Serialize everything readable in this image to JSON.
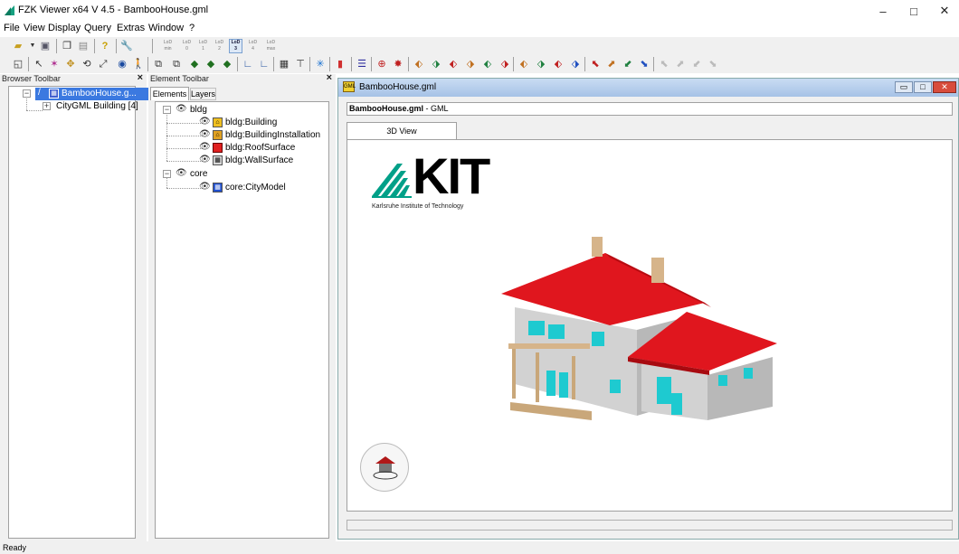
{
  "window": {
    "title": "FZK Viewer x64 V 4.5 - BambooHouse.gml",
    "controls": {
      "minimize": "–",
      "maximize": "□",
      "close": "✕"
    }
  },
  "menu": {
    "items": [
      "File",
      "View",
      "Display",
      "Query",
      "Extras",
      "Window",
      "?"
    ]
  },
  "lod_toolbar": {
    "buttons": [
      {
        "top": "LoD",
        "bottom": "min",
        "active": false
      },
      {
        "top": "LoD",
        "bottom": "0",
        "active": false
      },
      {
        "top": "LoD",
        "bottom": "1",
        "active": false
      },
      {
        "top": "LoD",
        "bottom": "2",
        "active": false
      },
      {
        "top": "LoD",
        "bottom": "3",
        "active": true
      },
      {
        "top": "LoD",
        "bottom": "4",
        "active": false
      },
      {
        "top": "LoD",
        "bottom": "max",
        "active": false
      }
    ]
  },
  "browser_panel": {
    "header": "Browser Toolbar",
    "close": "×",
    "root_label": "BambooHouse.g...",
    "child_label": "CityGML Building [4]"
  },
  "element_panel": {
    "header": "Element Toolbar",
    "close": "×",
    "tabs": [
      "Elements",
      "Layers"
    ],
    "groups": [
      {
        "name": "bldg",
        "items": [
          "bldg:Building",
          "bldg:BuildingInstallation",
          "bldg:RoofSurface",
          "bldg:WallSurface"
        ]
      },
      {
        "name": "core",
        "items": [
          "core:CityModel"
        ]
      }
    ]
  },
  "document": {
    "title": "BambooHouse.gml",
    "file_name": "BambooHouse.gml",
    "file_type": " - GML",
    "tab": "3D View",
    "logo_text": "KIT",
    "logo_subtitle": "Karlsruhe Institute of Technology"
  },
  "status": {
    "text": "Ready"
  },
  "colors": {
    "roof": "#e0161e",
    "wall": "#c4c4c4",
    "window": "#1ecad0",
    "wood": "#d6b48a",
    "kit_green": "#00a088",
    "selection": "#3b79e0"
  }
}
